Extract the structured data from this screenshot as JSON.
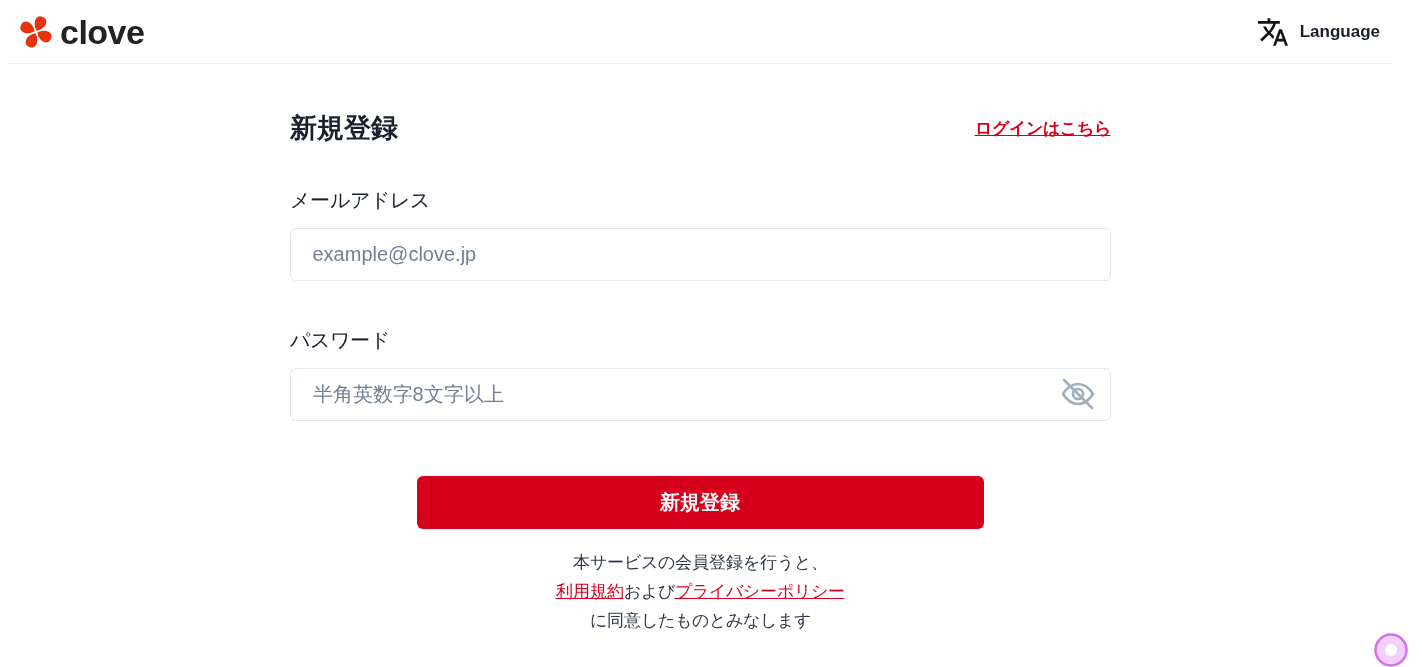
{
  "header": {
    "logo": "clove",
    "language_button": "Language"
  },
  "form": {
    "title": "新規登録",
    "login_link": "ログインはこちら",
    "fields": [
      {
        "kind": "email",
        "label": "メールアドレス",
        "placeholder": "example@clove.jp"
      },
      {
        "kind": "password",
        "label": "パスワード",
        "placeholder": "半角英数字8文字以上"
      }
    ],
    "submit_button": "新規登録",
    "terms": {
      "line_1": "本サービスの会員登録を行うと、",
      "terms_link": "利用規約",
      "joiner": "および",
      "privacy_link": "プライバシーポリシー",
      "line_3": "に同意したものとみなします"
    }
  }
}
